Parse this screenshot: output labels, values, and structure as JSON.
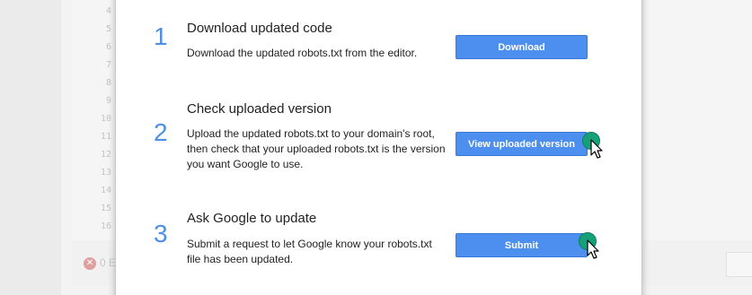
{
  "editor": {
    "line_numbers": [
      "4",
      "5",
      "6",
      "7",
      "8",
      "9",
      "10",
      "11",
      "12",
      "13",
      "14",
      "15",
      "16"
    ],
    "error_count": "0 E"
  },
  "dialog": {
    "steps": [
      {
        "number": "1",
        "title": "Download updated code",
        "description": "Download the updated robots.txt from the editor.",
        "button_label": "Download"
      },
      {
        "number": "2",
        "title": "Check uploaded version",
        "description": "Upload the updated robots.txt to your domain's root, then check that your uploaded robots.txt is the version you want Google to use.",
        "button_label": "View uploaded version"
      },
      {
        "number": "3",
        "title": "Ask Google to update",
        "description": "Submit a request to let Google know your robots.txt file has been updated.",
        "button_label": "Submit"
      }
    ]
  },
  "colors": {
    "accent": "#4d8fe6",
    "button": "#4d8fef",
    "click_marker": "#16a07a"
  },
  "icons": {
    "error": "error-circle-icon",
    "cursor": "mouse-pointer-icon"
  }
}
